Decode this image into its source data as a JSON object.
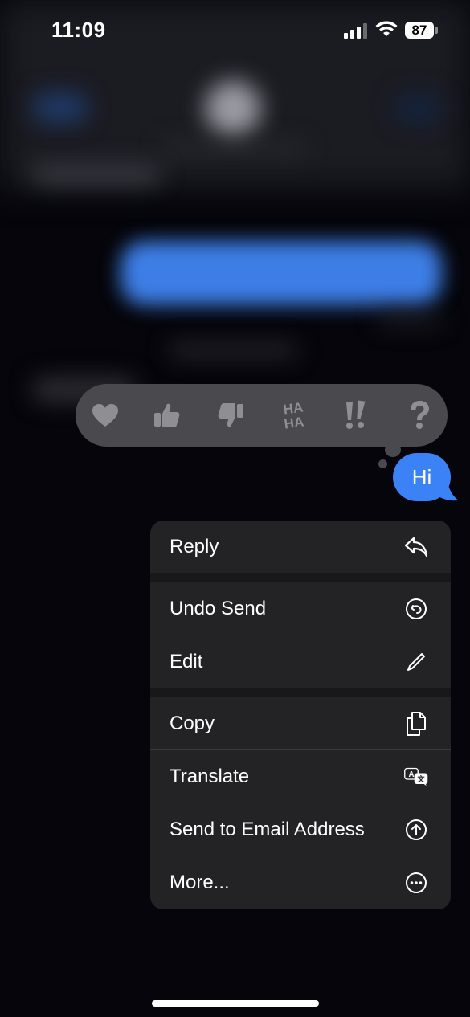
{
  "status_bar": {
    "time": "11:09",
    "battery": "87"
  },
  "tapbacks": [
    {
      "icon": "heart-icon"
    },
    {
      "icon": "thumbs-up-icon"
    },
    {
      "icon": "thumbs-down-icon"
    },
    {
      "icon": "haha-icon",
      "text": "HA HA"
    },
    {
      "icon": "exclamation-icon",
      "text": "!!"
    },
    {
      "icon": "question-icon",
      "text": "?"
    }
  ],
  "message": {
    "text": "Hi"
  },
  "menu": {
    "items": [
      {
        "label": "Reply",
        "icon": "reply-icon"
      },
      {
        "label": "Undo Send",
        "icon": "undo-send-icon"
      },
      {
        "label": "Edit",
        "icon": "pencil-icon"
      },
      {
        "label": "Copy",
        "icon": "copy-icon"
      },
      {
        "label": "Translate",
        "icon": "translate-icon"
      },
      {
        "label": "Send to Email Address",
        "icon": "arrow-up-circle-icon"
      },
      {
        "label": "More...",
        "icon": "more-icon"
      }
    ]
  },
  "colors": {
    "bubble": "#3b82f6",
    "menu_bg": "#232325",
    "tapback_bg": "#4a4a4e",
    "icon_gray": "#8e8e93"
  }
}
